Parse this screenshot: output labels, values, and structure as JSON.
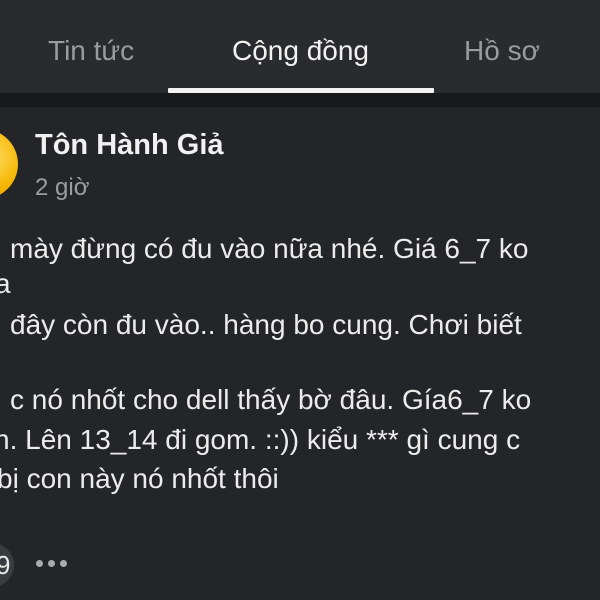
{
  "tabs": {
    "news": "Tin tức",
    "community": "Cộng đồng",
    "profile": "Hồ sơ"
  },
  "post": {
    "author": "Tôn Hành Giả",
    "time": "2 giờ",
    "lines": [
      "mày đừng có đu vào nữa nhé. Giá 6_7 ko",
      "a",
      "đây còn đu vào.. hàng bo cung. Chơi biết",
      "c nó nhốt cho dell thấy bờ đâu.  Gía6_7 ko",
      "n. Lên 13_14 đi gom. ::))  kiểu *** gì cung c",
      "bị con này nó nhốt thôi"
    ],
    "reaction_count": "9"
  },
  "colors": {
    "background": "#1f2022",
    "tab_active": "#f2f2f2",
    "tab_inactive": "#9a9b9e"
  }
}
